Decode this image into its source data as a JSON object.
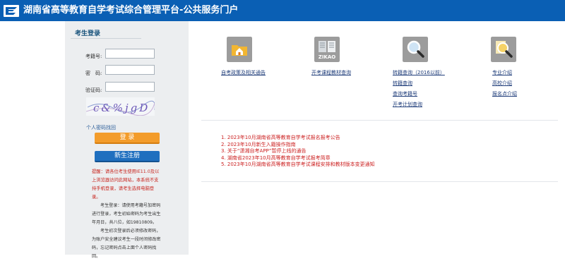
{
  "header": {
    "title": "湖南省高等教育自学考试综合管理平台-公共服务门户"
  },
  "login": {
    "title": "考生登录",
    "fields": [
      {
        "label": "考籍号:",
        "value": ""
      },
      {
        "label": "密　码:",
        "value": ""
      },
      {
        "label": "验证码:",
        "value": ""
      }
    ],
    "captcha_text": "c&%jgD",
    "forgot_password": "个人密码找回",
    "login_button": "登 录",
    "register_button": "新生注册",
    "notice": "提醒：请各位考生使用IE11.0及以上浏览器访问此网站，本系统不支持手机登录，请考生选择电脑登录。",
    "info": [
      "考生登录：请使用考籍号加密码进行登录，考生初始密码为考生出生年月日，共八位，如19810809。",
      "考生初次登录后必须修改密码，为账户安全建议考生一段时间修改密码，忘记密码点击上面个人密码找回。"
    ]
  },
  "quicklinks": [
    {
      "icon": "folder-house-icon",
      "links": [
        "自考政策及相关通告"
      ]
    },
    {
      "icon": "zikao-book-icon",
      "links": [
        "开考课程教材查询"
      ]
    },
    {
      "icon": "magnifier-icon",
      "links": [
        "转籍查询（2016以前）",
        "转籍查询",
        "查询考籍号",
        "开考计划查询"
      ]
    },
    {
      "icon": "search-school-icon",
      "links": [
        "专业介绍",
        "高校介绍",
        "报名点介绍"
      ]
    }
  ],
  "news": [
    "1.  2023年10月湖南省高等教育自学考试报名报考公告",
    "2.  2023年10月新生入籍操作指南",
    "3.  关于“潇湘自考APP”暂停上线的通告",
    "4.  湖南省2023年10月高等教育自学考试报考简章",
    "5.  2023年10月湖南省高等教育自学考试课程安排和教材版本变更通知"
  ],
  "colors": {
    "header": "#0a5fb4",
    "login_button": "#f39c2b",
    "register_button": "#1f6fbf",
    "notice": "#c8251e",
    "news": "#cc2222"
  }
}
